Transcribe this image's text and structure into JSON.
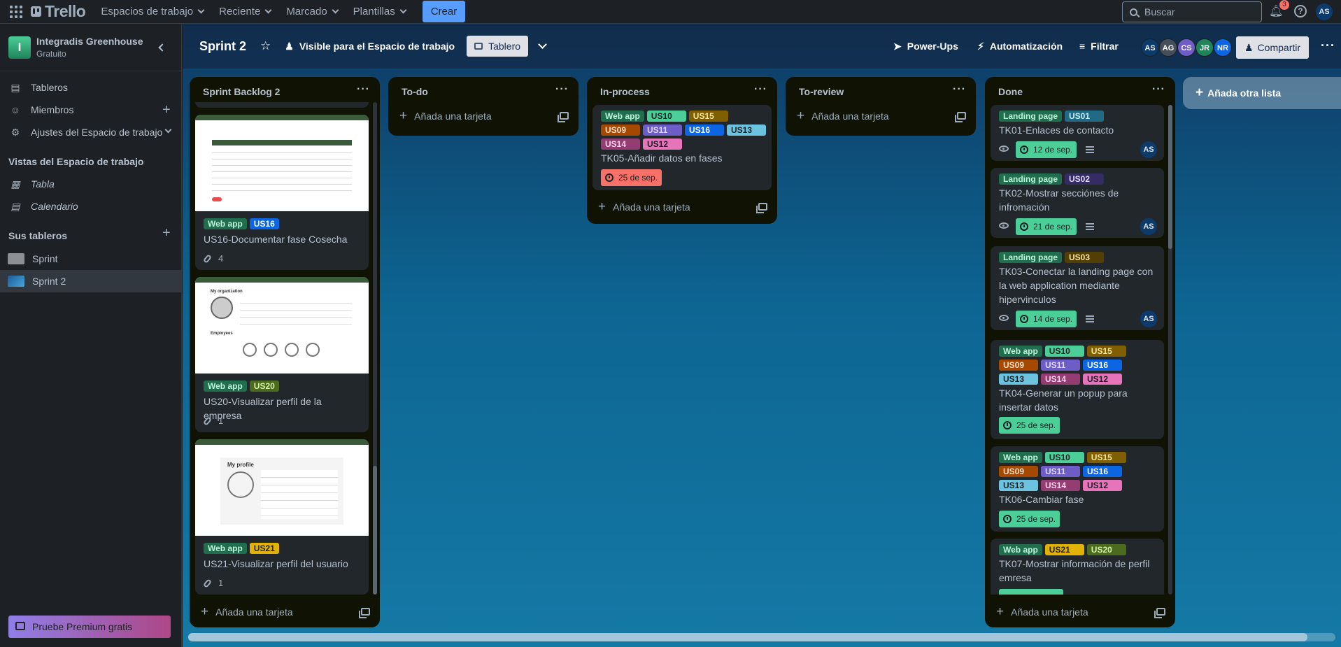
{
  "topbar": {
    "logo": "Trello",
    "nav": [
      "Espacios de trabajo",
      "Reciente",
      "Marcado",
      "Plantillas"
    ],
    "create": "Crear",
    "search_placeholder": "Buscar",
    "notifications": "3",
    "user_initials": "AS"
  },
  "sidebar": {
    "workspace_initial": "I",
    "workspace_name": "Integradis Greenhouse",
    "workspace_plan": "Gratuito",
    "items": [
      {
        "label": "Tableros",
        "icon": "boards-icon"
      },
      {
        "label": "Miembros",
        "icon": "person-icon"
      },
      {
        "label": "Ajustes del Espacio de trabajo",
        "icon": "gear-icon"
      }
    ],
    "views_heading": "Vistas del Espacio de trabajo",
    "views": [
      {
        "label": "Tabla"
      },
      {
        "label": "Calendario"
      }
    ],
    "boards_heading": "Sus tableros",
    "boards": [
      {
        "label": "Sprint",
        "color": "#8c8f94"
      },
      {
        "label": "Sprint 2",
        "color": "#3d8ecb"
      }
    ],
    "premium": "Pruebe Premium gratis"
  },
  "board": {
    "title": "Sprint 2",
    "visibility": "Visible para el Espacio de trabajo",
    "view": "Tablero",
    "powerups": "Power-Ups",
    "automation": "Automatización",
    "filter": "Filtrar",
    "members": [
      {
        "initials": "AS",
        "color": "#0c3a6b"
      },
      {
        "initials": "AG",
        "color": "#454f59"
      },
      {
        "initials": "CS",
        "color": "#6e5dc6"
      },
      {
        "initials": "JR",
        "color": "#1f845a"
      },
      {
        "initials": "NR",
        "color": "#0c66e4"
      }
    ],
    "share": "Compartir",
    "add_list": "Añada otra lista",
    "add_card": "Añada una tarjeta"
  },
  "lists": {
    "backlog": {
      "title": "Sprint Backlog 2",
      "cards": [
        {
          "labels": [
            "Web app",
            "US16"
          ],
          "title": "US16-Documentar fase Cosecha",
          "attachments": "4"
        },
        {
          "labels": [
            "Web app",
            "US20"
          ],
          "title": "US20-Visualizar perfil de la empresa",
          "attachments": "1"
        },
        {
          "labels": [
            "Web app",
            "US21"
          ],
          "title": "US21-Visualizar perfil del usuario",
          "attachments": "1"
        }
      ],
      "cover_text": {
        "org_title": "My organization",
        "employees": "Employees",
        "profile_title": "My profile"
      }
    },
    "todo": {
      "title": "To-do"
    },
    "inprocess": {
      "title": "In-process",
      "card": {
        "labels": [
          "Web app",
          "US10",
          "US15",
          "US09",
          "US11",
          "US16",
          "US13",
          "US14",
          "US12"
        ],
        "title": "TK05-Añadir datos en fases",
        "due": "25 de sep."
      }
    },
    "review": {
      "title": "To-review"
    },
    "done": {
      "title": "Done",
      "cards": [
        {
          "labels": [
            "Landing page",
            "US01"
          ],
          "title": "TK01-Enlaces de contacto",
          "due": "12 de sep.",
          "member": "AS"
        },
        {
          "labels": [
            "Landing page",
            "US02"
          ],
          "title": "TK02-Mostrar secciónes de infromación",
          "due": "21 de sep.",
          "member": "AS"
        },
        {
          "labels": [
            "Landing page",
            "US03"
          ],
          "title": "TK03-Conectar la landing page con la web application mediante hipervinculos",
          "due": "14 de sep.",
          "member": "AS"
        },
        {
          "labels": [
            "Web app",
            "US10",
            "US15",
            "US09",
            "US11",
            "US16",
            "US13",
            "US14",
            "US12"
          ],
          "title": "TK04-Generar un popup para insertar datos",
          "due": "25 de sep."
        },
        {
          "labels": [
            "Web app",
            "US10",
            "US15",
            "US09",
            "US11",
            "US16",
            "US13",
            "US14",
            "US12"
          ],
          "title": "TK06-Cambiar fase",
          "due": "25 de sep."
        },
        {
          "labels": [
            "Web app",
            "US21",
            "US20"
          ],
          "title": "TK07-Mostrar información de perfil emresa"
        }
      ]
    }
  },
  "label_colors": {
    "Web app": "#216e4e",
    "Landing page": "#216e4e",
    "US01": "#206a83",
    "US02": "#352c63",
    "US03": "#533f04",
    "US09": "#a54800",
    "US10": "#4bce97",
    "US11": "#6e5dc6",
    "US12": "#e774bb",
    "US13": "#6cc3e0",
    "US14": "#943d73",
    "US15": "#7f5f01",
    "US16": "#0c66e4",
    "US20": "#4c6b1f",
    "US21": "#e2b203"
  }
}
